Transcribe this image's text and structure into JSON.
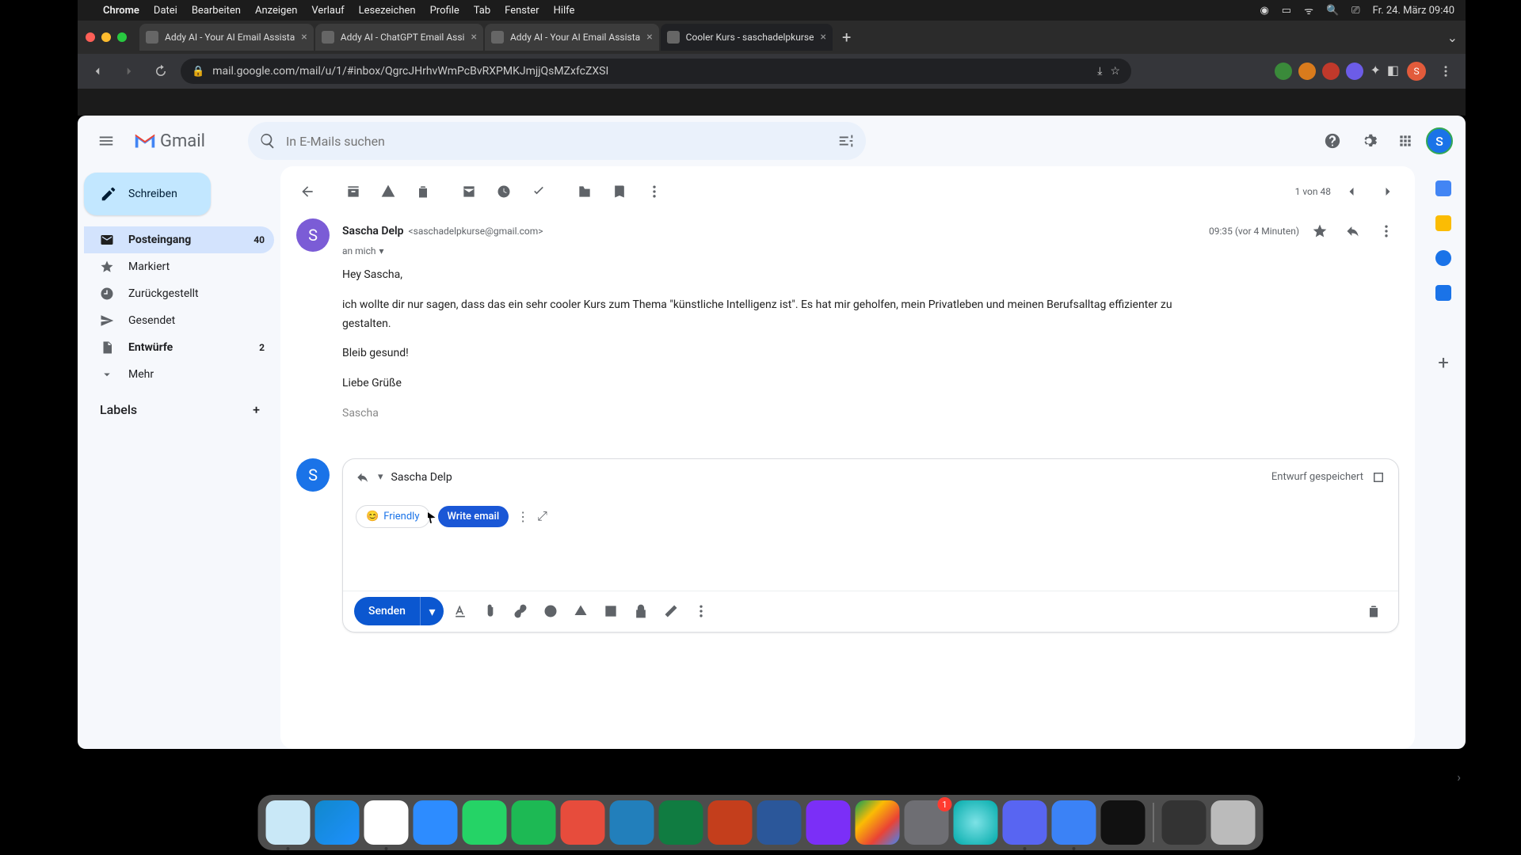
{
  "menubar": {
    "app": "Chrome",
    "items": [
      "Datei",
      "Bearbeiten",
      "Anzeigen",
      "Verlauf",
      "Lesezeichen",
      "Profile",
      "Tab",
      "Fenster",
      "Hilfe"
    ],
    "datetime": "Fr. 24. März  09:40"
  },
  "tabs": [
    {
      "title": "Addy AI - Your AI Email Assista",
      "active": false
    },
    {
      "title": "Addy AI - ChatGPT Email Assi",
      "active": false
    },
    {
      "title": "Addy AI - Your AI Email Assista",
      "active": false
    },
    {
      "title": "Cooler Kurs - saschadelpkurse",
      "active": true
    }
  ],
  "url": "mail.google.com/mail/u/1/#inbox/QgrcJHrhvWmPcBvRXPMKJmjjQsMZxfcZXSI",
  "gmail": {
    "brand": "Gmail",
    "search_placeholder": "In E-Mails suchen",
    "compose": "Schreiben",
    "nav": [
      {
        "label": "Posteingang",
        "count": "40",
        "active": true,
        "bold": true
      },
      {
        "label": "Markiert"
      },
      {
        "label": "Zurückgestellt"
      },
      {
        "label": "Gesendet"
      },
      {
        "label": "Entwürfe",
        "count": "2",
        "bold": true
      },
      {
        "label": "Mehr"
      }
    ],
    "labels_header": "Labels",
    "pager": "1 von 48",
    "sender_name": "Sascha Delp",
    "sender_email": "<saschadelpkurse@gmail.com>",
    "to_label": "an mich",
    "timestamp": "09:35 (vor 4 Minuten)",
    "body": {
      "l1": "Hey Sascha,",
      "l2": "ich wollte dir nur sagen, dass das ein sehr cooler Kurs zum Thema \"künstliche Intelligenz ist\". Es hat mir geholfen, mein Privatleben und meinen Berufsalltag effizienter zu gestalten.",
      "l3": "Bleib gesund!",
      "l4": "Liebe Grüße",
      "l5": "Sascha"
    },
    "reply": {
      "to": "Sascha Delp",
      "status": "Entwurf gespeichert",
      "tone_chip": "Friendly",
      "write_chip": "Write email",
      "send": "Senden"
    },
    "avatar_letter": "S"
  },
  "dock_colors": [
    "#2aa9e0",
    "#1e90ff",
    "#f7c948",
    "#ff9500",
    "#2fa4e7",
    "#4285f4",
    "#25d366",
    "#1db954",
    "#e74c3c",
    "#227fbb",
    "#107c41",
    "#c43e1c",
    "#b7472a",
    "#2b579a",
    "#7b2ff7",
    "linear",
    "#6e6e73",
    "#2ec4c6",
    "#5865f2",
    "#3b82f6",
    "#555",
    "#222",
    "#444"
  ]
}
